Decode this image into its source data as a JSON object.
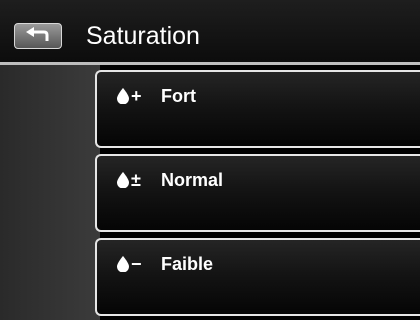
{
  "header": {
    "title": "Saturation",
    "back_icon": "back-arrow-icon"
  },
  "options": [
    {
      "sign": "+",
      "label": "Fort",
      "icon": "drop-icon"
    },
    {
      "sign": "±",
      "label": "Normal",
      "icon": "drop-icon"
    },
    {
      "sign": "−",
      "label": "Faible",
      "icon": "drop-icon"
    }
  ],
  "colors": {
    "background": "#000000",
    "text": "#ffffff",
    "border": "#e6e6e6"
  }
}
